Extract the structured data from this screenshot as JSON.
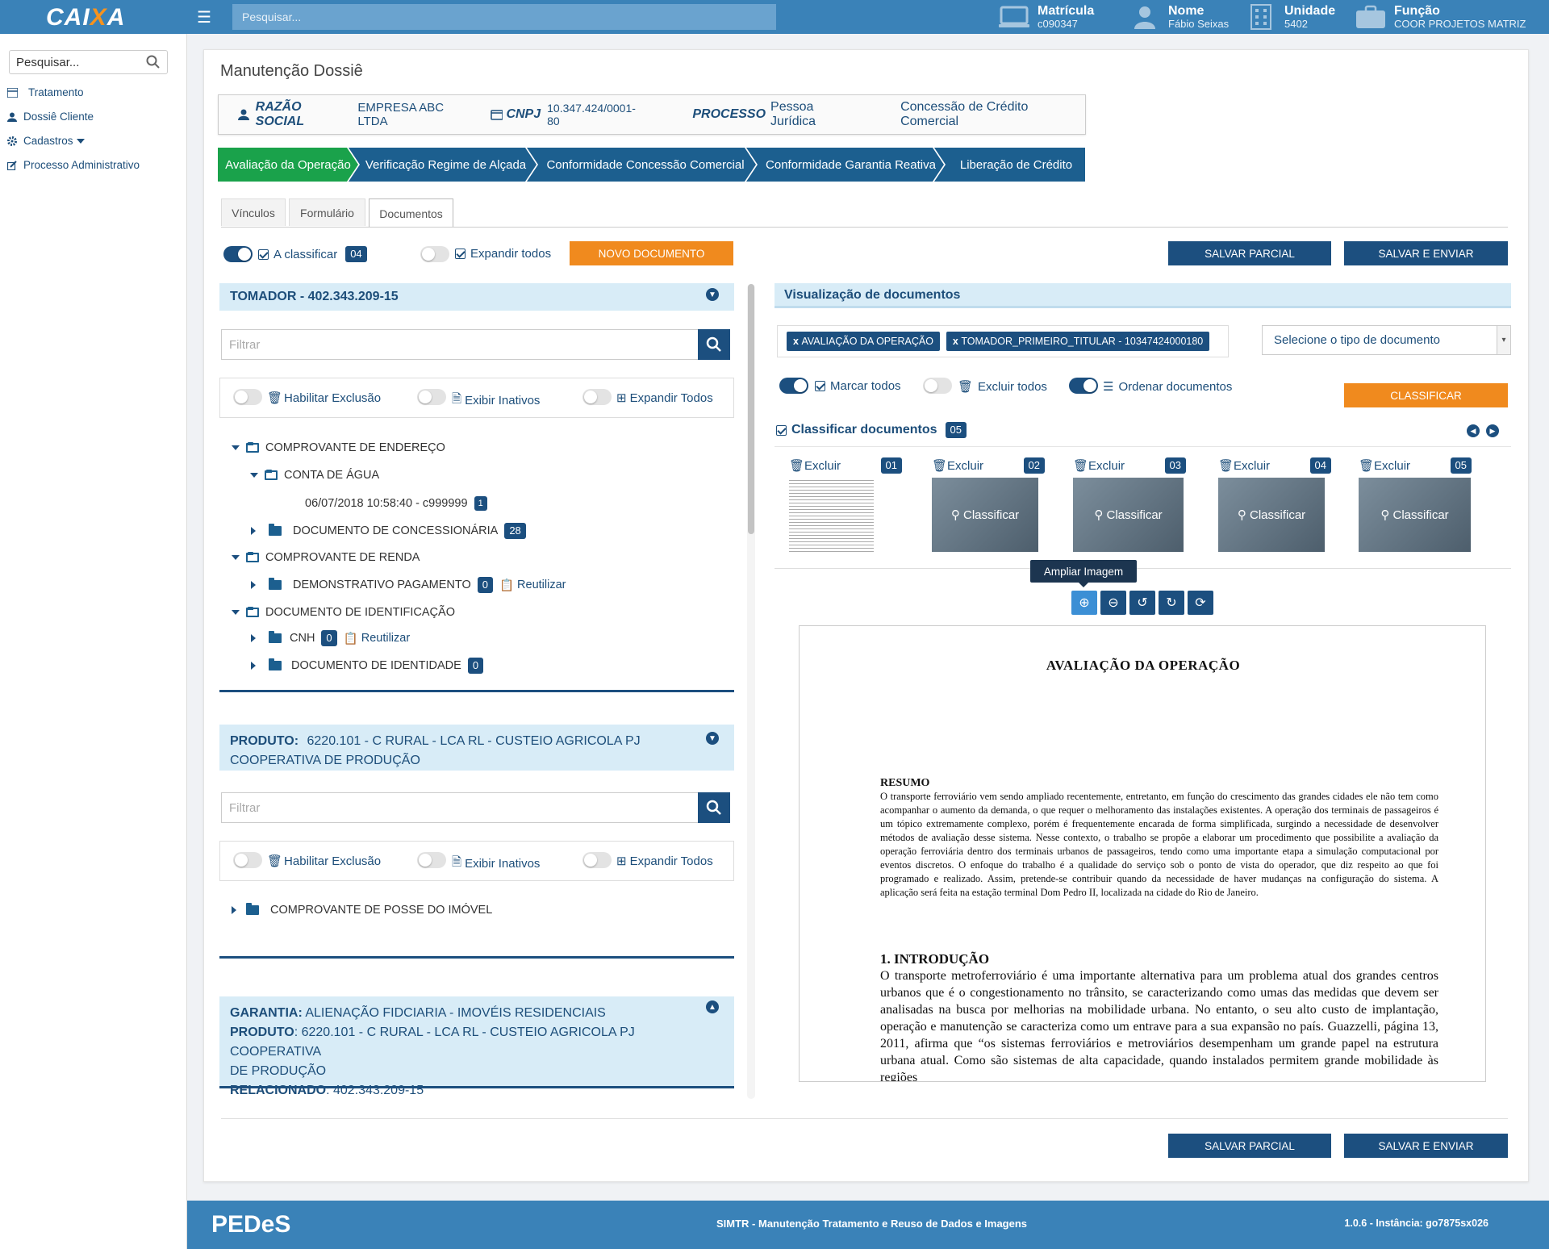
{
  "header": {
    "logo_text": "CAIXA",
    "logo_main": "CAI",
    "logo_accent": "X",
    "logo_end": "A",
    "search_placeholder": "Pesquisar...",
    "matricula_label": "Matrícula",
    "matricula_value": "c090347",
    "nome_label": "Nome",
    "nome_value": "Fábio Seixas",
    "unidade_label": "Unidade",
    "unidade_value": "5402",
    "funcao_label": "Função",
    "funcao_value": "COOR PROJETOS MATRIZ"
  },
  "sidebar": {
    "search_placeholder": "Pesquisar...",
    "items": [
      {
        "label": "Tratamento"
      },
      {
        "label": "Dossiê Cliente"
      },
      {
        "label": "Cadastros"
      },
      {
        "label": "Processo Administrativo"
      }
    ]
  },
  "page": {
    "title": "Manutenção Dossiê"
  },
  "info": {
    "razao_label": "RAZÃO SOCIAL",
    "razao_value": "EMPRESA ABC LTDA",
    "cnpj_label": "CNPJ",
    "cnpj_value": "10.347.424/0001-80",
    "processo_label": "PROCESSO",
    "processo_value": "Pessoa Jurídica",
    "concessao": "Concessão de Crédito Comercial"
  },
  "steps": [
    {
      "label": "Avaliação da Operação"
    },
    {
      "label": "Verificação Regime de Alçada"
    },
    {
      "label": "Conformidade Concessão Comercial"
    },
    {
      "label": "Conformidade Garantia Reativa"
    },
    {
      "label": "Liberação de Crédito"
    }
  ],
  "tabs": [
    {
      "label": "Vínculos"
    },
    {
      "label": "Formulário"
    },
    {
      "label": "Documentos"
    }
  ],
  "toolbar": {
    "a_classificar": "A classificar",
    "a_classificar_count": "04",
    "expandir_todos": "Expandir todos",
    "novo_documento": "NOVO DOCUMENTO",
    "salvar_parcial": "SALVAR PARCIAL",
    "salvar_enviar": "SALVAR E ENVIAR"
  },
  "tomador": {
    "title": "TOMADOR - 402.343.209-15",
    "filter_placeholder": "Filtrar",
    "opt_habilitar": "Habilitar Exclusão",
    "opt_inativos": "Exibir Inativos",
    "opt_expandir": "Expandir Todos",
    "tree": {
      "comp_endereco": "COMPROVANTE DE ENDEREÇO",
      "conta_agua": "CONTA DE ÁGUA",
      "conta_agua_file": "06/07/2018 10:58:40 - c999999",
      "conta_agua_file_count": "1",
      "doc_concessionaria": "DOCUMENTO DE CONCESSIONÁRIA",
      "doc_concessionaria_count": "28",
      "comp_renda": "COMPROVANTE DE RENDA",
      "demonstrativo": "DEMONSTRATIVO PAGAMENTO",
      "demonstrativo_count": "0",
      "reutilizar": "Reutilizar",
      "doc_identificacao": "DOCUMENTO DE IDENTIFICAÇÃO",
      "cnh": "CNH",
      "cnh_count": "0",
      "doc_identidade": "DOCUMENTO DE IDENTIDADE",
      "doc_identidade_count": "0"
    }
  },
  "produto": {
    "label": "PRODUTO:",
    "value_line1": "6220.101 - C RURAL - LCA RL - CUSTEIO AGRICOLA PJ",
    "value_line2": "COOPERATIVA DE PRODUÇÃO",
    "filter_placeholder": "Filtrar",
    "opt_habilitar": "Habilitar Exclusão",
    "opt_inativos": "Exibir Inativos",
    "opt_expandir": "Expandir Todos",
    "tree_item": "COMPROVANTE DE POSSE DO IMÓVEL"
  },
  "garantia": {
    "garantia_label": "GARANTIA:",
    "garantia_value": "ALIENAÇÃO FIDCIARIA - IMOVÉIS RESIDENCIAIS",
    "produto_label": "PRODUTO",
    "produto_value_line1": ": 6220.101 - C RURAL - LCA RL - CUSTEIO AGRICOLA PJ COOPERATIVA",
    "produto_value_line2": "DE PRODUÇÃO",
    "relacionado_label": "RELACIONADO",
    "relacionado_value": ": 402.343.209-15"
  },
  "viewer_panel": {
    "title": "Visualização de documentos",
    "tags": [
      "AVALIAÇÃO DA OPERAÇÃO",
      "TOMADOR_PRIMEIRO_TITULAR - 10347424000180"
    ],
    "tag_x": "x",
    "select_placeholder": "Selecione o tipo de documento",
    "marcar_todos": "Marcar todos",
    "excluir_todos": "Excluir todos",
    "ordenar": "Ordenar documentos",
    "classificar_btn": "CLASSIFICAR",
    "classificar_title": "Classificar documentos",
    "classificar_count": "05",
    "thumbs": [
      {
        "excluir": "Excluir",
        "num": "01",
        "overlay": ""
      },
      {
        "excluir": "Excluir",
        "num": "02",
        "overlay": "Classificar"
      },
      {
        "excluir": "Excluir",
        "num": "03",
        "overlay": "Classificar"
      },
      {
        "excluir": "Excluir",
        "num": "04",
        "overlay": "Classificar"
      },
      {
        "excluir": "Excluir",
        "num": "05",
        "overlay": "Classificar"
      }
    ],
    "tooltip": "Ampliar Imagem"
  },
  "document": {
    "title": "AVALIAÇÃO DA OPERAÇÃO",
    "resumo_title": "RESUMO",
    "resumo_text": "O transporte ferroviário vem sendo ampliado recentemente, entretanto, em função do crescimento das grandes cidades ele não tem como acompanhar o aumento da demanda, o que requer o melhoramento das instalações existentes. A operação dos terminais de passageiros é um tópico extremamente complexo, porém é frequentemente encarada de forma simplificada, surgindo a necessidade de desenvolver métodos de avaliação desse sistema. Nesse contexto, o trabalho se propõe a elaborar um procedimento que possibilite a avaliação da operação ferroviária dentro dos terminais urbanos de passageiros, tendo como uma importante etapa a simulação computacional por eventos discretos. O enfoque do trabalho é a qualidade do serviço sob o ponto de vista do operador, que diz respeito ao que foi programado e realizado. Assim, pretende-se contribuir quando da necessidade de haver mudanças na configuração do sistema. A aplicação será feita na estação terminal Dom Pedro II, localizada na cidade do Rio de Janeiro.",
    "intro_title": "1. INTRODUÇÃO",
    "intro_text": "O transporte metroferroviário é uma importante alternativa para um problema atual dos grandes centros urbanos que é o congestionamento no trânsito, se caracterizando como umas das medidas que devem ser analisadas na busca por melhorias na mobilidade urbana. No entanto, o seu alto custo de implantação, operação e manutenção se caracteriza como um entrave para a sua expansão no país. Guazzelli, página 13, 2011, afirma que “os sistemas ferroviários e metroviários desempenham um grande papel na estrutura urbana atual. Como são sistemas de alta capacidade, quando instalados permitem grande mobilidade às regiões"
  },
  "footer": {
    "logo": "PEDeS",
    "center": "SIMTR - Manutenção Tratamento e Reuso de Dados e Imagens",
    "right": "1.0.6 - Instância: go7875sx026"
  }
}
